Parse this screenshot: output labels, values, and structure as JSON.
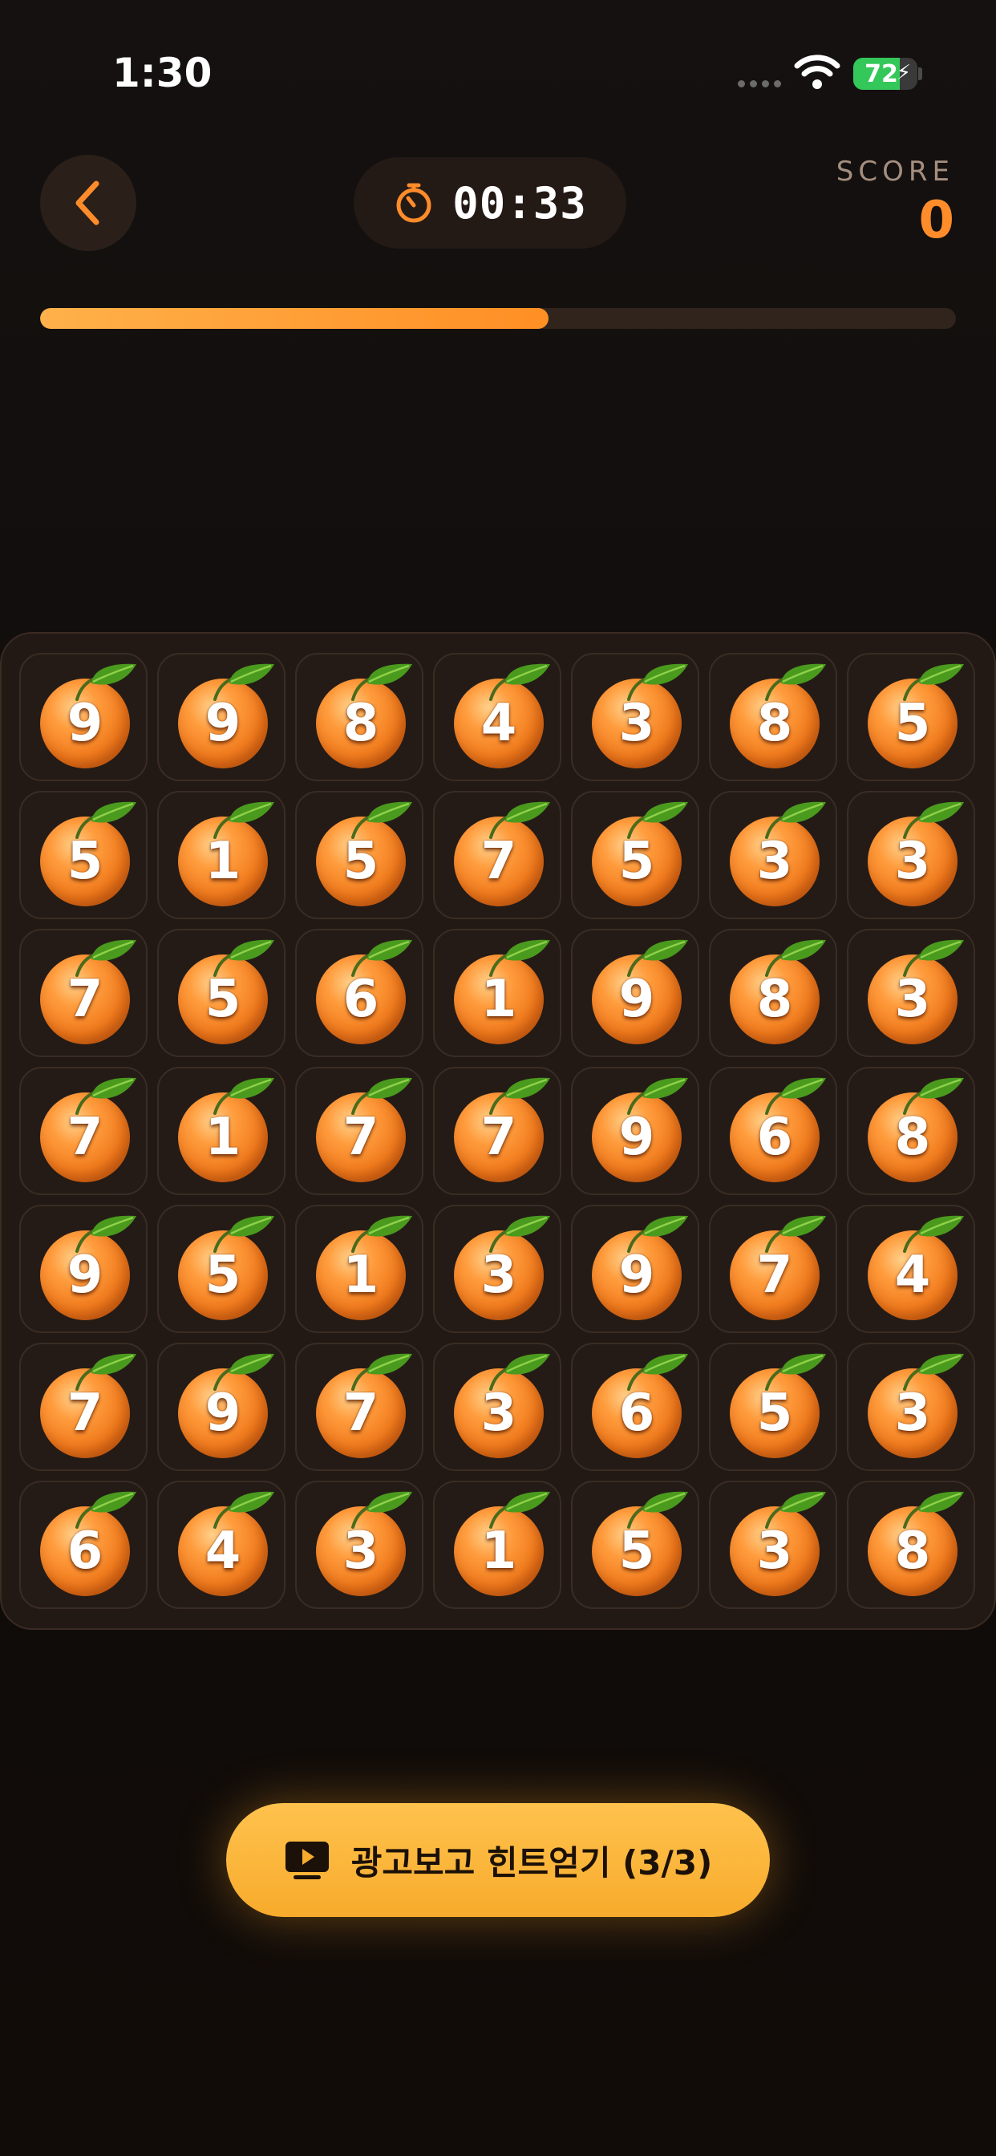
{
  "status_bar": {
    "time": "1:30",
    "battery_percent": "72"
  },
  "header": {
    "timer": "00:33",
    "score_label": "SCORE",
    "score_value": "0"
  },
  "progress": {
    "fraction": 0.555
  },
  "board": {
    "rows": [
      [
        "9",
        "9",
        "8",
        "4",
        "3",
        "8",
        "5"
      ],
      [
        "5",
        "1",
        "5",
        "7",
        "5",
        "3",
        "3"
      ],
      [
        "7",
        "5",
        "6",
        "1",
        "9",
        "8",
        "3"
      ],
      [
        "7",
        "1",
        "7",
        "7",
        "9",
        "6",
        "8"
      ],
      [
        "9",
        "5",
        "1",
        "3",
        "9",
        "7",
        "4"
      ],
      [
        "7",
        "9",
        "7",
        "3",
        "6",
        "5",
        "3"
      ],
      [
        "6",
        "4",
        "3",
        "1",
        "5",
        "3",
        "8"
      ]
    ]
  },
  "hint_button": {
    "label": "광고보고 힌트얻기 (3/3)",
    "icon": "play-ad-icon"
  },
  "colors": {
    "accent": "#ff8c2a",
    "button": "#f7ab2c",
    "battery": "#34c759"
  }
}
